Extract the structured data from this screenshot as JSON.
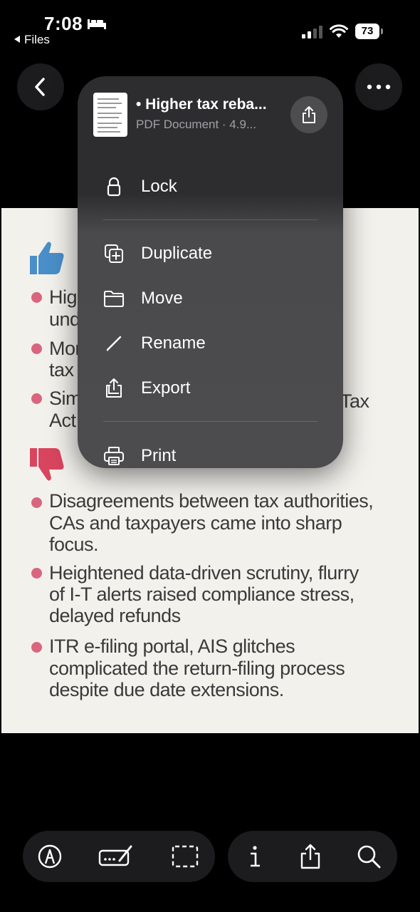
{
  "status_bar": {
    "time": "7:08",
    "back_app": "Files",
    "battery": "73"
  },
  "menu": {
    "file_title": "• Higher tax reba...",
    "file_subtitle": "PDF Document · 4.9...",
    "items": [
      {
        "label": "Lock",
        "icon": "lock-icon"
      },
      {
        "label": "Duplicate",
        "icon": "duplicate-icon"
      },
      {
        "label": "Move",
        "icon": "folder-icon"
      },
      {
        "label": "Rename",
        "icon": "pencil-icon"
      },
      {
        "label": "Export",
        "icon": "export-icon"
      },
      {
        "label": "Print",
        "icon": "printer-icon"
      }
    ]
  },
  "document": {
    "pro_lines": [
      "Hig",
      "und",
      "Mor",
      "tax",
      "Sim",
      "Act"
    ],
    "pro_right_lines": [
      "r",
      "Tax"
    ],
    "con_lines": [
      "Disagreements between tax authorities,",
      "CAs and taxpayers came into sharp",
      "focus.",
      "Heightened data-driven scrutiny, flurry",
      "of I-T alerts raised compliance stress,",
      "delayed refunds",
      "ITR e-filing portal, AIS glitches",
      "complicated the return-filing process",
      "despite due date extensions."
    ]
  },
  "toolbar": {
    "left": [
      "markup-icon",
      "autofill-icon",
      "select-icon"
    ],
    "right": [
      "info-icon",
      "share-icon",
      "search-icon"
    ]
  },
  "colors": {
    "menu_bg": "#4c4c4e",
    "bullet": "#d9657f",
    "thumb_up": "#4a8fc9",
    "thumb_down": "#d9455f"
  }
}
